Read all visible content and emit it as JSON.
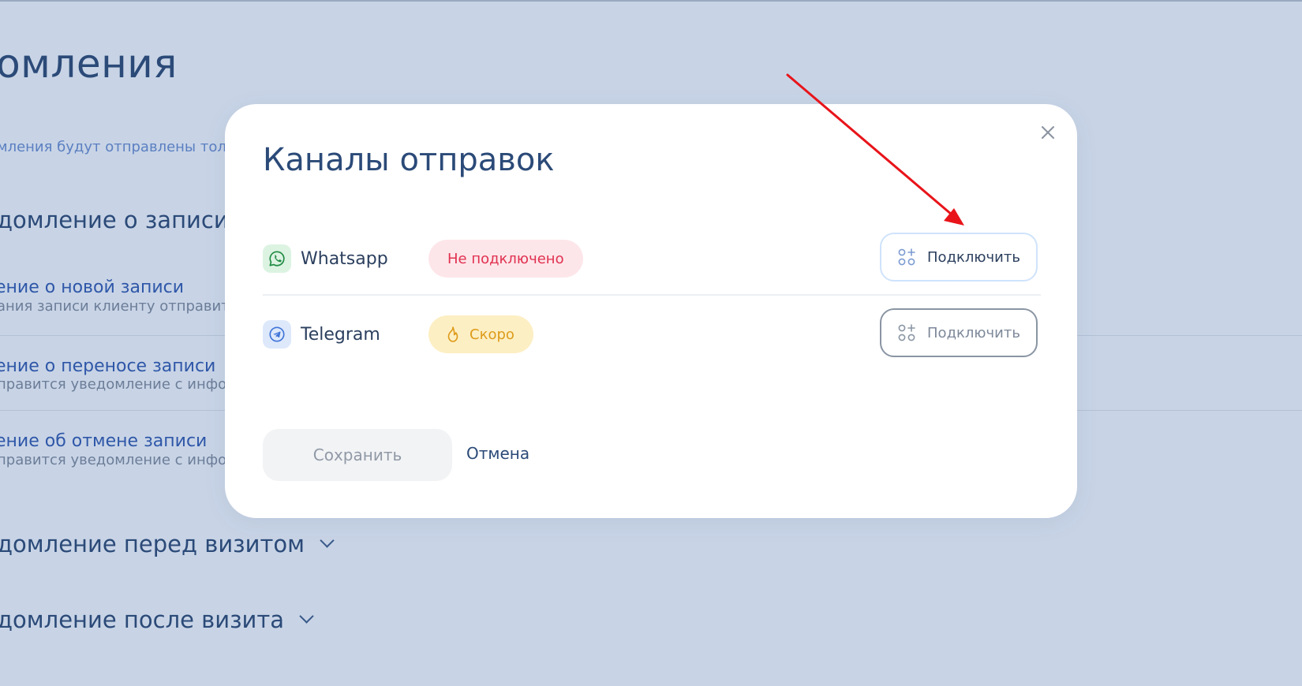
{
  "background": {
    "title": "домления",
    "subtitle": "мления будут отправлены тол",
    "section_record": "домление о записи",
    "items": [
      {
        "title": "ение о новой записи",
        "desc": "ания записи клиенту отправит"
      },
      {
        "title": "ение о переносе записи",
        "desc": "правится уведомление с инфо"
      },
      {
        "title": "ение об отмене записи",
        "desc": "правится уведомление с инфо"
      }
    ],
    "section_before": "домление перед визитом",
    "section_after": "домление после визита"
  },
  "modal": {
    "title": "Каналы отправок",
    "channels": [
      {
        "name": "Whatsapp",
        "status": "Не подключено",
        "status_color": "#e0314f",
        "icon": "whatsapp-icon",
        "button": "Подключить"
      },
      {
        "name": "Telegram",
        "status": "Скоро",
        "status_color": "#dd9b1a",
        "icon": "telegram-icon",
        "button": "Подключить"
      }
    ],
    "save_label": "Сохранить",
    "cancel_label": "Отмена"
  },
  "colors": {
    "overlay": "#c8d4e6",
    "primary_text": "#2b4a78",
    "annotation_arrow": "#e8141a"
  }
}
